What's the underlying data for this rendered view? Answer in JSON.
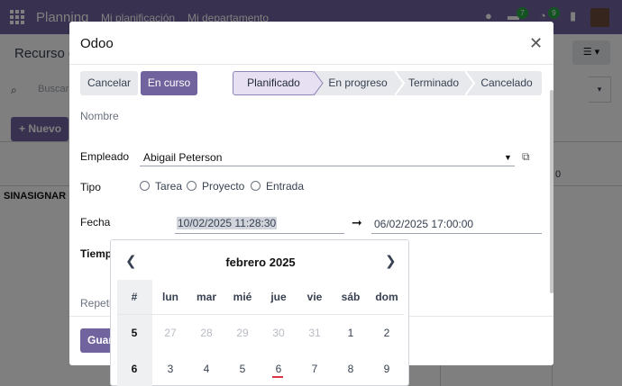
{
  "navbar": {
    "brand": "Planning",
    "menu": [
      "Mi planificación",
      "Mi departamento"
    ],
    "badges": [
      "7",
      "9"
    ]
  },
  "page": {
    "title_partial": "Recurso d",
    "search_placeholder": "Buscar",
    "new_button": "Nuevo",
    "unassigned_label": "SINASIGNAR",
    "gantt_fragment": "0"
  },
  "modal": {
    "title": "Odoo",
    "buttons": {
      "cancel": "Cancelar",
      "in_progress": "En curso",
      "save_partial": "Guar"
    },
    "stages": [
      "Planificado",
      "En progreso",
      "Terminado",
      "Cancelado"
    ],
    "active_stage": "Planificado",
    "fields": {
      "name_label": "Nombre",
      "employee_label": "Empleado",
      "employee_value": "Abigail Peterson",
      "type_label": "Tipo",
      "type_options": [
        "Tarea",
        "Proyecto",
        "Entrada"
      ],
      "date_label": "Fecha",
      "date_start": "10/02/2025 11:28:30",
      "date_end": "06/02/2025 17:00:00",
      "time_label_partial": "Tiemp",
      "repeat_label_partial": "Repeti"
    }
  },
  "datepicker": {
    "month_label": "febrero 2025",
    "headers": [
      "#",
      "lun",
      "mar",
      "mié",
      "jue",
      "vie",
      "sáb",
      "dom"
    ],
    "rows": [
      {
        "week": "5",
        "days": [
          "27",
          "28",
          "29",
          "30",
          "31",
          "1",
          "2"
        ],
        "current_month_from": 5
      },
      {
        "week": "6",
        "days": [
          "3",
          "4",
          "5",
          "6",
          "7",
          "8",
          "9"
        ],
        "current_month_from": 0
      }
    ],
    "today": "6"
  },
  "colors": {
    "brand": "#71639e",
    "stage_active_bg": "#e6e0f2",
    "badge": "#28a745"
  }
}
